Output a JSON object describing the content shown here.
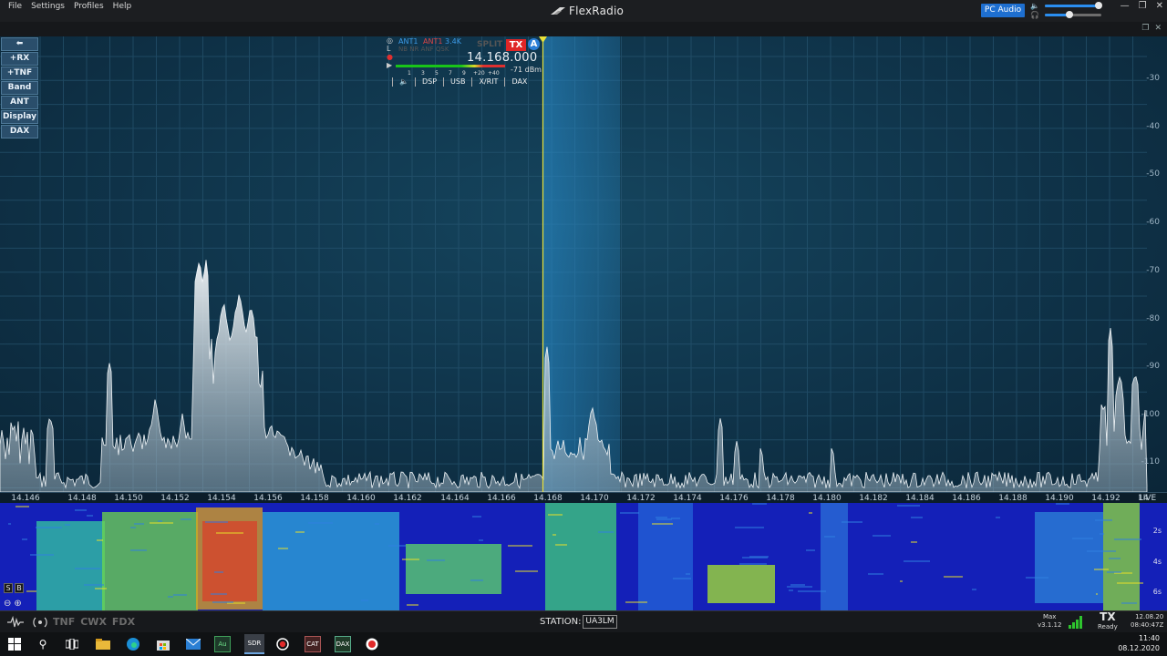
{
  "menu": [
    "File",
    "Settings",
    "Profiles",
    "Help"
  ],
  "brand": "FlexRadio",
  "pc_audio_label": "PC Audio",
  "left_buttons": [
    "⬅",
    "+RX",
    "+TNF",
    "Band",
    "ANT",
    "Display",
    "DAX"
  ],
  "dbm_scale": [
    "-30",
    "-40",
    "-50",
    "-60",
    "-70",
    "-80",
    "-90",
    "-100",
    "-110"
  ],
  "freq_ticks": [
    "14.146",
    "14.148",
    "14.150",
    "14.152",
    "14.154",
    "14.156",
    "14.158",
    "14.160",
    "14.162",
    "14.164",
    "14.166",
    "14.168",
    "14.170",
    "14.172",
    "14.174",
    "14.176",
    "14.178",
    "14.180",
    "14.182",
    "14.184",
    "14.186",
    "14.188",
    "14.190",
    "14.192",
    "14"
  ],
  "live_label": "LIVE",
  "waterfall_times": [
    "2s",
    "4s",
    "6s"
  ],
  "slice": {
    "rx_ant": "ANT1",
    "tx_ant": "ANT1",
    "bandwidth": "3.4K",
    "dsp_flags": "NB NR ANF QSK",
    "split": "SPLIT",
    "tx": "TX",
    "letter": "A",
    "frequency": "14.168.000",
    "meter_scale": [
      "1",
      "3",
      "5",
      "7",
      "9",
      "+20",
      "+40"
    ],
    "signal": "-71 dBm",
    "buttons": [
      "🔈",
      "DSP",
      "USB",
      "X/RIT",
      "DAX"
    ],
    "side_icons": [
      "◎",
      "L",
      "●",
      "▶"
    ]
  },
  "status": {
    "modes": [
      "TNF",
      "CWX",
      "FDX"
    ],
    "station_label": "STATION:",
    "station_value": "UA3LM",
    "max_label": "Max",
    "version": "v3.1.12",
    "tx_label": "TX",
    "tx_state": "Ready",
    "date_utc": "12.08.20",
    "time_utc": "08:40:47Z"
  },
  "taskbar": {
    "time": "11:40",
    "date": "08.12.2020"
  },
  "colors": {
    "accent_blue": "#1e6fd0",
    "tx_red": "#e02626",
    "slice_yellow": "#e9e23a"
  }
}
